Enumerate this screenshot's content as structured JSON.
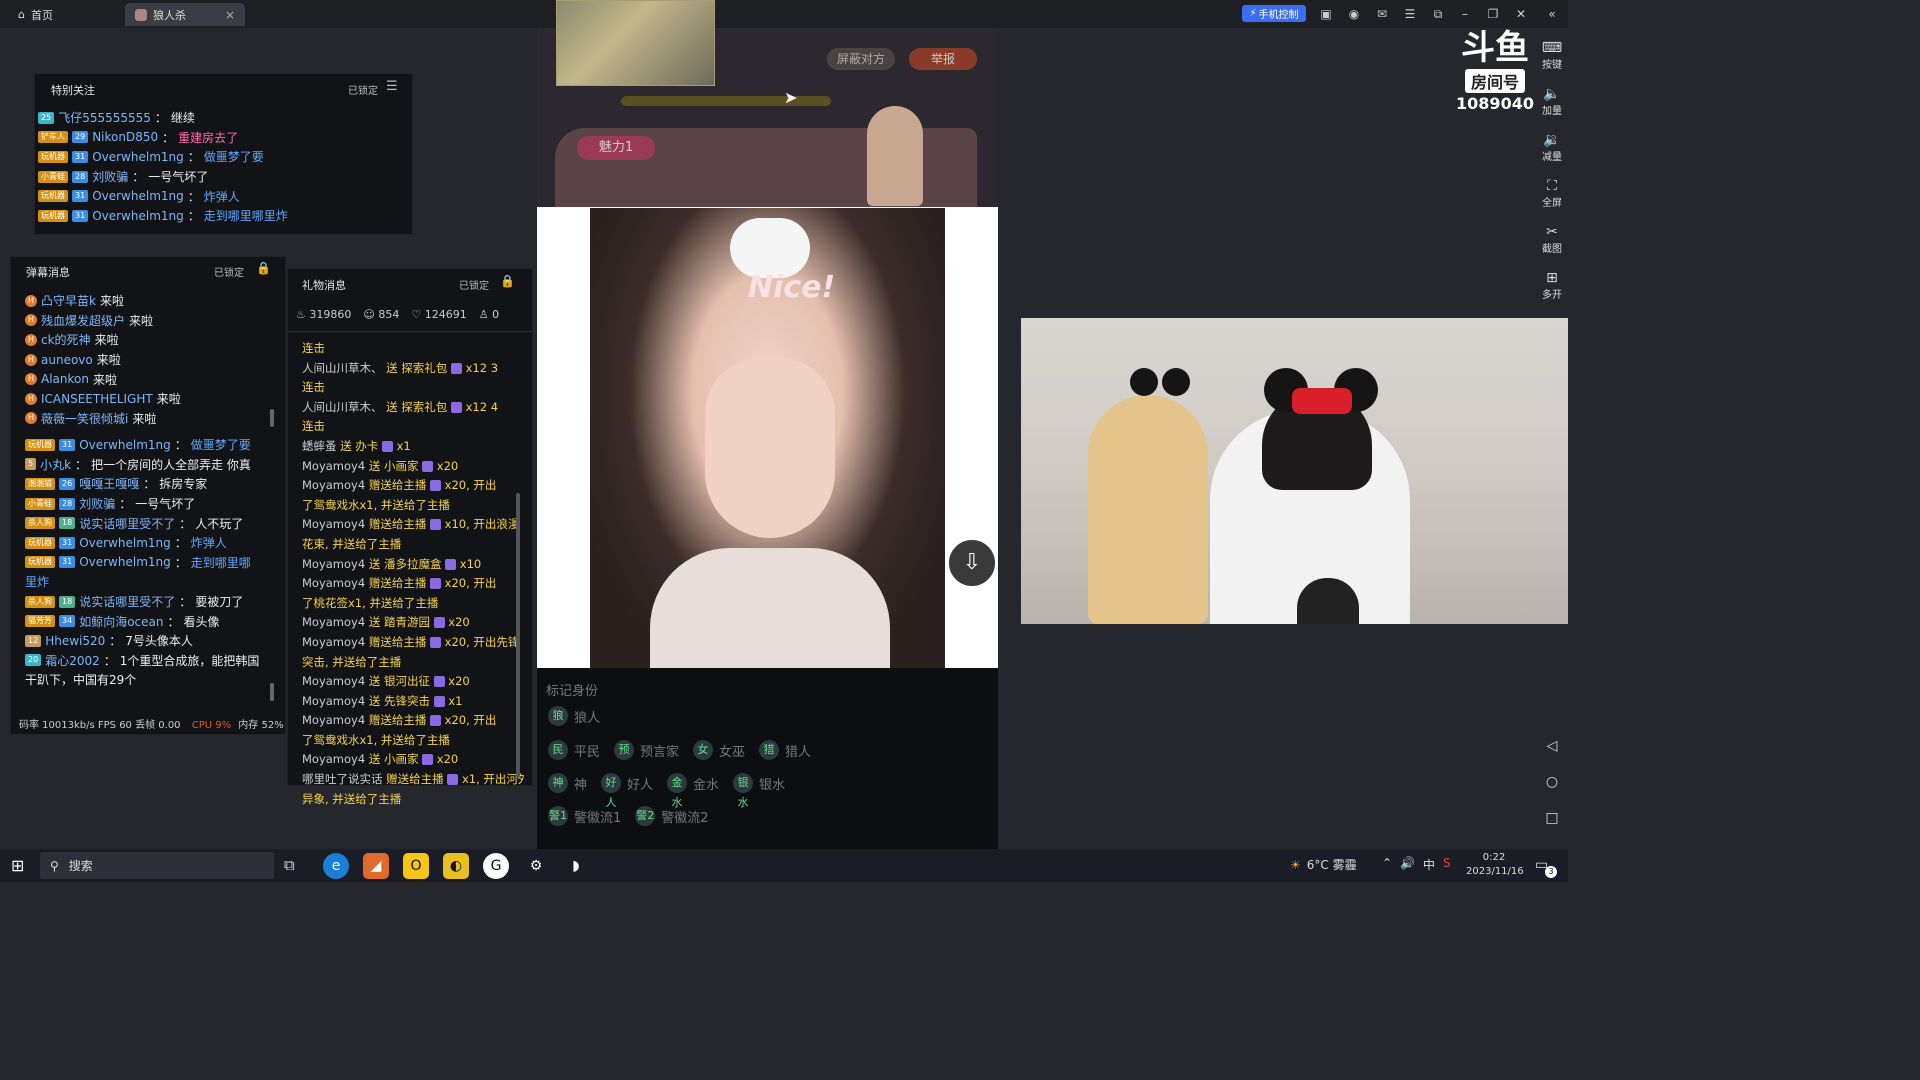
{
  "tabs": [
    {
      "label": "首页"
    },
    {
      "label": "狼人杀"
    }
  ],
  "phone_control": "手机控制",
  "special_follow": {
    "title": "特别关注",
    "lock": "已锁定",
    "messages": [
      {
        "badge_level": "25",
        "user": "飞仔555555555",
        "text": "继续"
      },
      {
        "badge_name": "铲车人",
        "badge_level": "29",
        "user": "NikonD850",
        "text": "重建房去了"
      },
      {
        "badge_name": "玩机器",
        "badge_level": "31",
        "user": "Overwhelm1ng",
        "text": "做噩梦了要"
      },
      {
        "badge_name": "小青蛙",
        "badge_level": "28",
        "user": "刘败骗",
        "text": "一号气坏了"
      },
      {
        "badge_name": "玩机器",
        "badge_level": "31",
        "user": "Overwhelm1ng",
        "text": "炸弹人"
      },
      {
        "badge_name": "玩机器",
        "badge_level": "31",
        "user": "Overwhelm1ng",
        "text": "走到哪里哪里炸"
      }
    ]
  },
  "danmaku": {
    "title": "弹幕消息",
    "lock": "已锁定",
    "arrivals": [
      {
        "user": "凸守早苗k",
        "text": "来啦"
      },
      {
        "user": "残血爆发超级户",
        "text": "来啦"
      },
      {
        "user": "ck的死神",
        "text": "来啦"
      },
      {
        "user": "auneovo",
        "text": "来啦"
      },
      {
        "user": "Alankon",
        "text": "来啦"
      },
      {
        "user": "ICANSEETHELIGHT",
        "text": "来啦"
      },
      {
        "user": "薇薇一笑很倾城i",
        "text": "来啦"
      }
    ],
    "messages": [
      {
        "badge_name": "玩机器",
        "badge_level": "31",
        "user": "Overwhelm1ng",
        "text": "做噩梦了要"
      },
      {
        "badge_level": "5",
        "user": "小丸k",
        "text": "把一个房间的人全部弄走 你真"
      },
      {
        "badge_name": "潮潮猫",
        "badge_level": "26",
        "user": "嘎嘎王嘎嘎",
        "text": "拆房专家"
      },
      {
        "badge_name": "小青蛙",
        "badge_level": "28",
        "user": "刘败骗",
        "text": "一号气坏了"
      },
      {
        "badge_name": "杀人狗",
        "badge_level": "18",
        "user": "说实话哪里受不了",
        "text": "人不玩了"
      },
      {
        "badge_name": "玩机器",
        "badge_level": "31",
        "user": "Overwhelm1ng",
        "text": "炸弹人"
      },
      {
        "badge_name": "玩机器",
        "badge_level": "31",
        "user": "Overwhelm1ng",
        "text": "走到哪里哪"
      },
      {
        "continuation": "里炸"
      },
      {
        "badge_name": "杀人狗",
        "badge_level": "18",
        "user": "说实话哪里受不了",
        "text": "要被刀了"
      },
      {
        "badge_name": "猫芳芳",
        "badge_level": "34",
        "user": "如鲸向海ocean",
        "text": "看头像"
      },
      {
        "badge_level": "12",
        "user": "Hhewi520",
        "text": "7号头像本人"
      },
      {
        "badge_level": "20",
        "user": "霜心2002",
        "text": "1个重型合成旅，能把韩国"
      },
      {
        "continuation": "干趴下，中国有29个"
      }
    ],
    "stats": "码率 10013kb/s FPS 60 丢帧 0.00",
    "cpu": "CPU 9%",
    "mem": "内存 52%"
  },
  "gifts": {
    "title": "礼物消息",
    "lock": "已锁定",
    "stat_hot": "319860",
    "stat_viewers": "854",
    "stat_likes": "124691",
    "stat_other": "0",
    "lines": [
      {
        "combo": "连击"
      },
      {
        "user": "人间山川草木、",
        "action": "送 探索礼包",
        "count": "x12 3"
      },
      {
        "combo": "连击"
      },
      {
        "user": "人间山川草木、",
        "action": "送 探索礼包",
        "count": "x12 4"
      },
      {
        "combo": "连击"
      },
      {
        "user": "蟋蟀蚤",
        "action": "送 办卡",
        "count": "x1"
      },
      {
        "user": "Moyamoy4",
        "action": "送 小画家",
        "count": "x20"
      },
      {
        "user": "Moyamoy4",
        "action": "赠送给主播",
        "count": "x20, 开出"
      },
      {
        "cont": "了鸳鸯戏水x1, 并送给了主播"
      },
      {
        "user": "Moyamoy4",
        "action": "赠送给主播",
        "count": "x10, 开出浪漫"
      },
      {
        "cont": "花束, 并送给了主播"
      },
      {
        "user": "Moyamoy4",
        "action": "送 潘多拉魔盒",
        "count": "x10"
      },
      {
        "user": "Moyamoy4",
        "action": "赠送给主播",
        "count": "x20, 开出"
      },
      {
        "cont": "了桃花签x1, 并送给了主播"
      },
      {
        "user": "Moyamoy4",
        "action": "送 踏青游园",
        "count": "x20"
      },
      {
        "user": "Moyamoy4",
        "action": "赠送给主播",
        "count": "x20, 开出先锋"
      },
      {
        "cont": "突击, 并送给了主播"
      },
      {
        "user": "Moyamoy4",
        "action": "送 银河出征",
        "count": "x20"
      },
      {
        "user": "Moyamoy4",
        "action": "送 先锋突击",
        "count": "x1"
      },
      {
        "user": "Moyamoy4",
        "action": "赠送给主播",
        "count": "x20, 开出"
      },
      {
        "cont": "了鸳鸯戏水x1, 并送给了主播"
      },
      {
        "user": "Moyamoy4",
        "action": "送 小画家",
        "count": "x20"
      },
      {
        "user": "哪里吐了说实话",
        "action": "赠送给主播",
        "count": "x1, 开出河外"
      },
      {
        "cont": "异象, 并送给了主播"
      }
    ]
  },
  "game": {
    "block_btn": "屏蔽对方",
    "report_btn": "举报",
    "charm": "魅力1",
    "mark_title": "标记身份",
    "roles_row1": [
      {
        "short": "狼",
        "label": "狼人"
      }
    ],
    "roles_row2": [
      {
        "short": "民",
        "label": "平民"
      },
      {
        "short": "预",
        "label": "预言家"
      },
      {
        "short": "女",
        "label": "女巫"
      },
      {
        "short": "猎",
        "label": "猎人"
      }
    ],
    "roles_row3": [
      {
        "short": "神",
        "label": "神"
      },
      {
        "short": "好人",
        "label": "好人"
      },
      {
        "short": "金水",
        "label": "金水"
      },
      {
        "short": "银水",
        "label": "银水"
      }
    ],
    "roles_row4": [
      {
        "short": "警1",
        "label": "警徽流1"
      },
      {
        "short": "警2",
        "label": "警徽流2"
      }
    ],
    "sticker_text": "Nice!"
  },
  "room": {
    "logo_line1": "斗鱼",
    "logo_line2": "房间号",
    "room_id": "1089040"
  },
  "side_buttons": [
    "按键",
    "加量",
    "减量",
    "全屏",
    "截图",
    "多开"
  ],
  "taskbar": {
    "search": "搜索",
    "weather": "6°C 雾霾",
    "time": "0:22",
    "date": "2023/11/16",
    "notif_count": "3"
  }
}
